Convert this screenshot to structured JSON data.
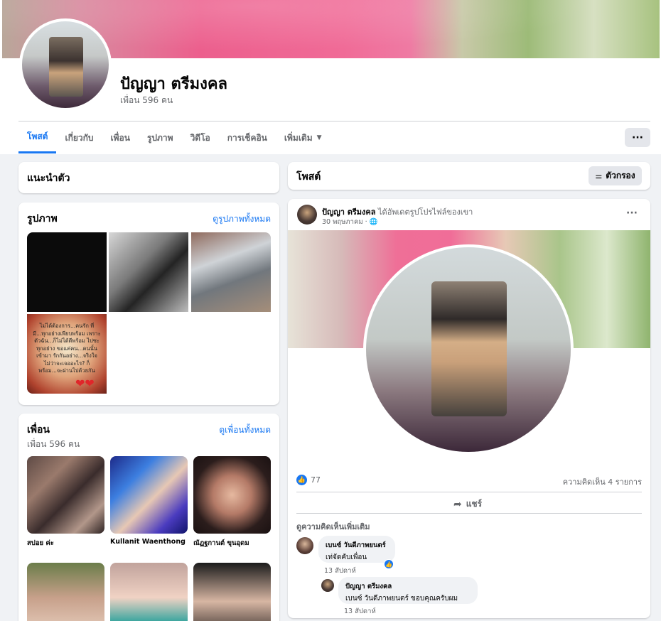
{
  "profile": {
    "name": "ปัญญา ตรีมงคล",
    "friends_count": "เพื่อน 596 คน"
  },
  "tabs": [
    {
      "label": "โพสต์"
    },
    {
      "label": "เกี่ยวกับ"
    },
    {
      "label": "เพื่อน"
    },
    {
      "label": "รูปภาพ"
    },
    {
      "label": "วิดีโอ"
    },
    {
      "label": "การเช็คอิน"
    },
    {
      "label": "เพิ่มเติม"
    }
  ],
  "more_button": "···",
  "intro": {
    "title": "แนะนำตัว"
  },
  "photos": {
    "title": "รูปภาพ",
    "see_all": "ดูรูปภาพทั้งหมด",
    "quote": "ไม่ได้ต้องการ...คนรัก ที่มี...ทุกอย่างเพียบพร้อม เพราะตัวฉัน...ก็ไม่ได้ดีพร้อม ไปซะทุกอย่าง ขอแค่คน...คนนั้นเข้ามา รักกันอย่าง...จริงใจ ไม่ว่าจะเจออะไร? ก็พร้อม...จะผ่านไปด้วยกัน",
    "hearts": "❤❤"
  },
  "friends": {
    "title": "เพื่อน",
    "see_all": "ดูเพื่อนทั้งหมด",
    "count": "เพื่อน 596 คน",
    "items": [
      {
        "name": "สปอย ค่ะ"
      },
      {
        "name": "Kullanit Waenthong"
      },
      {
        "name": "ณัฏฐกานต์ ขุนอุดม"
      },
      {
        "name": ""
      },
      {
        "name": ""
      },
      {
        "name": ""
      }
    ]
  },
  "posts": {
    "title": "โพสต์",
    "filter_label": "ตัวกรอง",
    "filter_icon": "⚌"
  },
  "post": {
    "author": "ปัญญา ตรีมงคล",
    "action": " ได้อัพเดตรูปโปรไฟล์ของเขา",
    "time": "30 พฤษภาคม · 🌐",
    "menu": "···",
    "likes": "77",
    "comment_count": "ความคิดเห็น 4 รายการ",
    "share_label": "แชร์",
    "share_icon": "➦",
    "more_comments": "ดูความคิดเห็นเพิ่มเติม",
    "comments": [
      {
        "name": "เบนซ์ วันดีภาพยนตร์",
        "text": "เท่จัดคับเพื่อน",
        "time": "13 สัปดาห์"
      },
      {
        "name": "ปัญญา ตรีมงคล",
        "text": "เบนซ์ วันดีภาพยนตร์ ขอบคุณครับผม",
        "time": "13 สัปดาห์"
      }
    ]
  },
  "icons": {
    "like": "👍",
    "caret": "▼"
  },
  "colors": {
    "accent": "#1877f2",
    "background": "#f0f2f5",
    "secondary_text": "#65676b"
  }
}
